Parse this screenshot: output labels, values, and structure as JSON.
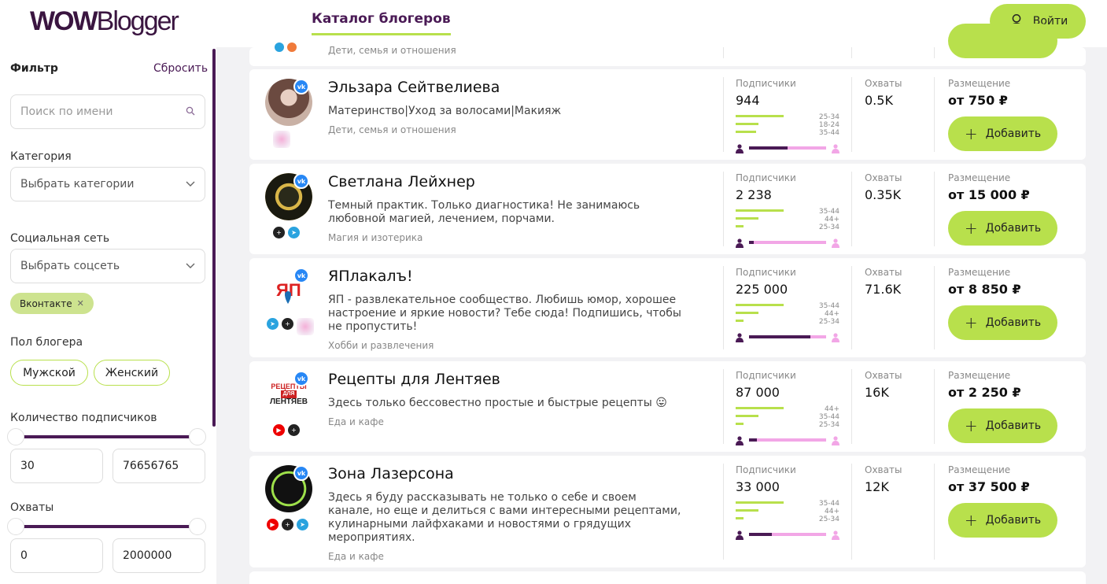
{
  "header": {
    "logo_bold": "WOW",
    "logo_light": "Blogger",
    "nav_tab": "Каталог блогеров",
    "login_label": "Войти"
  },
  "filter": {
    "title": "Фильтр",
    "reset": "Сбросить",
    "search_placeholder": "Поиск по имени",
    "category_label": "Категория",
    "category_placeholder": "Выбрать категории",
    "social_label": "Социальная сеть",
    "social_placeholder": "Выбрать соцсеть",
    "social_chip": "Вконтакте",
    "gender_label": "Пол блогера",
    "gender_male": "Мужской",
    "gender_female": "Женский",
    "subs_label": "Количество подписчиков",
    "subs_min": "30",
    "subs_max": "76656765",
    "reach_label": "Охваты",
    "reach_min": "0",
    "reach_max": "2000000"
  },
  "labels": {
    "subscribers": "Подписчики",
    "reach": "Охваты",
    "placement": "Размещение",
    "add": "Добавить"
  },
  "top_partial": {
    "category": "Дети, семья и отношения"
  },
  "bloggers": [
    {
      "name": "Эльзара Сейтвелиева",
      "description": "Материнство|Уход за волосами|Макияж",
      "category": "Дети, семья и отношения",
      "subscribers": "944",
      "reach": "0.5K",
      "price": "от 750 ₽",
      "ages": [
        "25-34",
        "18-24",
        "35-44"
      ],
      "age_shares": [
        0.48,
        0.23,
        0.2
      ],
      "male_share": 0.5,
      "socials": [
        "instagram"
      ]
    },
    {
      "name": "Светлана Лейхнер",
      "description": "Темный практик. Только диагностика! Не занимаюсь любовной магией, лечением, порчами.",
      "category": "Магия и изотерика",
      "subscribers": "2 238",
      "reach": "0.35K",
      "price": "от 15 000 ₽",
      "ages": [
        "35-44",
        "44+",
        "25-34"
      ],
      "age_shares": [
        0.48,
        0.23,
        0.08
      ],
      "male_share": 0.06,
      "socials": [
        "threads",
        "telegram"
      ]
    },
    {
      "name": "ЯПлакалъ!",
      "description": "ЯП - развлекательное сообщество. Любишь юмор, хорошее настроение и яркие новости? Тебе сюда! Подпишись, чтобы не пропустить!",
      "category": "Хобби и развлечения",
      "subscribers": "225 000",
      "reach": "71.6K",
      "price": "от 8 850 ₽",
      "ages": [
        "35-44",
        "44+",
        "25-34"
      ],
      "age_shares": [
        0.48,
        0.23,
        0.08
      ],
      "male_share": 0.8,
      "socials": [
        "telegram",
        "threads",
        "instagram"
      ]
    },
    {
      "name": "Рецепты для Лентяев",
      "description": "Здесь только бессовестно простые и быстрые рецепты 😛",
      "category": "Еда и кафе",
      "subscribers": "87 000",
      "reach": "16K",
      "price": "от 2 250 ₽",
      "ages": [
        "44+",
        "35-44",
        "25-34"
      ],
      "age_shares": [
        0.48,
        0.23,
        0.08
      ],
      "male_share": 0.1,
      "socials": [
        "youtube",
        "threads"
      ]
    },
    {
      "name": "Зона Лазерсона",
      "description": "Здесь я буду рассказывать не только о себе и своем канале, но еще и делиться с вами интересными рецептами, кулинарными лайфхаками и новостями о грядущих мероприятиях.",
      "category": "Еда и кафе",
      "subscribers": "33 000",
      "reach": "12K",
      "price": "от 37 500 ₽",
      "ages": [
        "35-44",
        "44+",
        "25-34"
      ],
      "age_shares": [
        0.48,
        0.23,
        0.08
      ],
      "male_share": 0.3,
      "socials": [
        "youtube",
        "threads",
        "telegram"
      ]
    }
  ],
  "colors": {
    "accent": "#b8e04c",
    "brand": "#4a1a55",
    "female": "#f2a6e6",
    "vk": "#2787f5"
  }
}
